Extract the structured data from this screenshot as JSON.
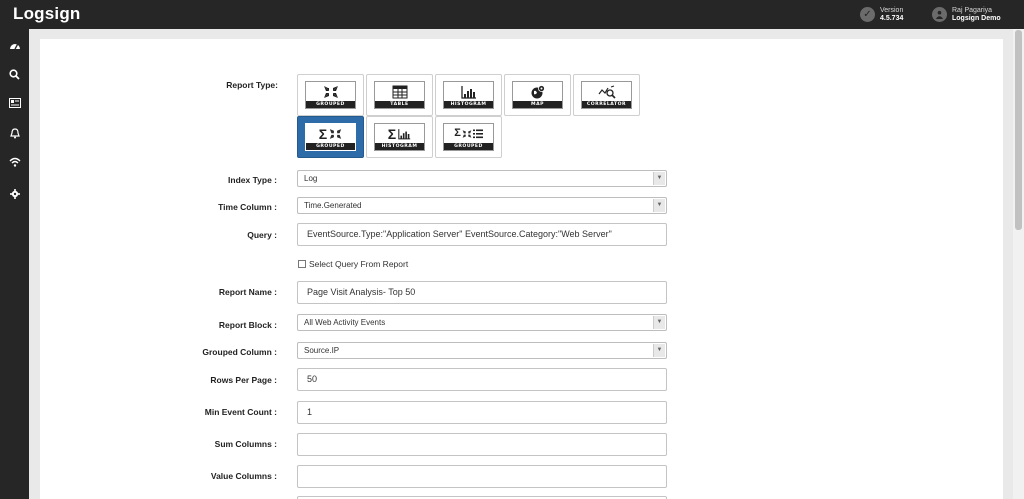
{
  "header": {
    "logo": "Logsign",
    "version_label": "Version",
    "version_value": "4.5.734",
    "user_name": "Raj Pagariya",
    "user_org": "Logsign Demo"
  },
  "sidebar": {
    "items": [
      {
        "icon": "dashboard-icon"
      },
      {
        "icon": "search-icon"
      },
      {
        "icon": "report-icon"
      },
      {
        "icon": "bell-icon"
      },
      {
        "icon": "wifi-icon"
      },
      {
        "icon": "gear-icon"
      }
    ]
  },
  "form": {
    "report_type_label": "Report Type:",
    "report_types": [
      {
        "caption": "GROUPED",
        "icon": "grouped-icon",
        "selected": false
      },
      {
        "caption": "TABLE",
        "icon": "table-icon",
        "selected": false
      },
      {
        "caption": "HISTOGRAM",
        "icon": "histogram-icon",
        "selected": false
      },
      {
        "caption": "MAP",
        "icon": "map-icon",
        "selected": false
      },
      {
        "caption": "CORRELATOR",
        "icon": "correlator-icon",
        "selected": false
      },
      {
        "caption": "GROUPED",
        "icon": "sum-grouped-icon",
        "selected": true
      },
      {
        "caption": "HISTOGRAM",
        "icon": "sum-histogram-icon",
        "selected": false
      },
      {
        "caption": "GROUPED",
        "icon": "sum-grouped-list-icon",
        "selected": false
      }
    ],
    "index_type_label": "Index Type :",
    "index_type_value": "Log",
    "time_column_label": "Time Column :",
    "time_column_value": "Time.Generated",
    "query_label": "Query :",
    "query_value": "EventSource.Type:\"Application Server\" EventSource.Category:\"Web Server\"",
    "select_query_label": "Select Query From Report",
    "report_name_label": "Report Name :",
    "report_name_value": "Page Visit Analysis- Top 50",
    "report_block_label": "Report Block :",
    "report_block_value": "All Web Activity Events",
    "grouped_column_label": "Grouped Column :",
    "grouped_column_value": "Source.IP",
    "rows_per_page_label": "Rows Per Page :",
    "rows_per_page_value": "50",
    "min_event_count_label": "Min Event Count :",
    "min_event_count_value": "1",
    "sum_columns_label": "Sum Columns :",
    "sum_columns_value": "",
    "value_columns_label": "Value Columns :",
    "value_columns_value": ""
  },
  "colors": {
    "topbar": "#262626",
    "selected_tile": "#2d6ca8",
    "background": "#e9e9e9"
  }
}
